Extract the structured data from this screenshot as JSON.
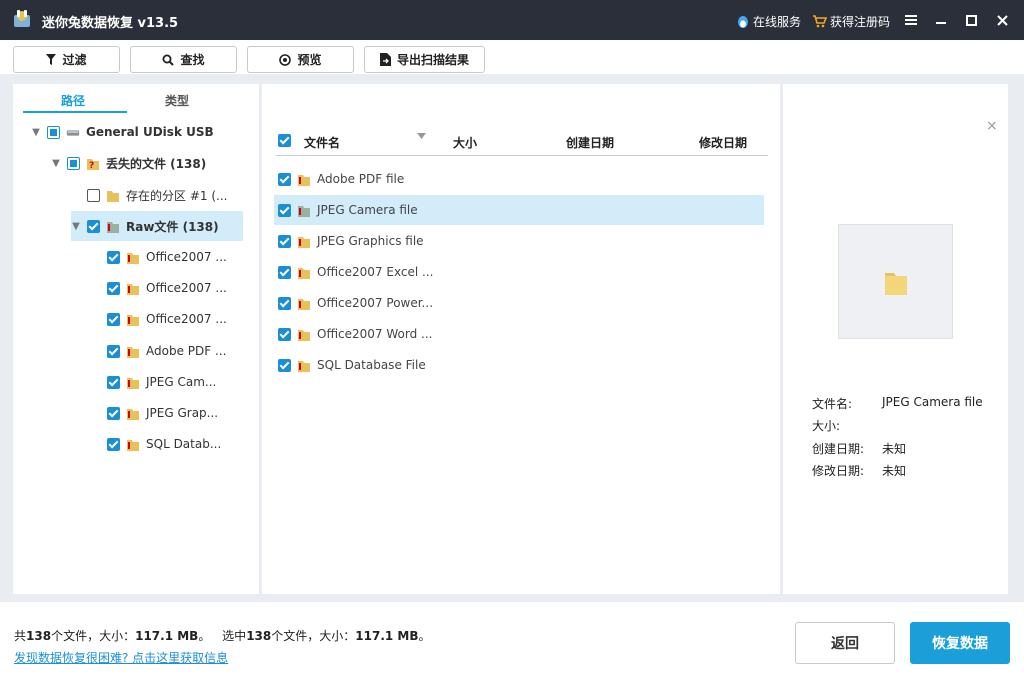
{
  "title": "迷你兔数据恢复 v13.5",
  "header": {
    "online_service": "在线服务",
    "get_code": "获得注册码"
  },
  "toolbar": {
    "filter": "过滤",
    "find": "查找",
    "preview": "预览",
    "export": "导出扫描结果"
  },
  "tabs": [
    "路径",
    "类型"
  ],
  "tree": [
    {
      "label": "General UDisk USB",
      "state": "partial",
      "expanded": true
    },
    {
      "label": "丢失的文件 (138)",
      "state": "partial",
      "expanded": true
    },
    {
      "label": "存在的分区 #1 (...",
      "state": "off"
    },
    {
      "label": "Raw文件 (138)",
      "state": "on",
      "expanded": true
    },
    {
      "label": "Office2007 ...",
      "state": "on"
    },
    {
      "label": "Office2007 ...",
      "state": "on"
    },
    {
      "label": "Office2007 ...",
      "state": "on"
    },
    {
      "label": "Adobe PDF ...",
      "state": "on"
    },
    {
      "label": "JPEG Cam...",
      "state": "on"
    },
    {
      "label": "JPEG Grap...",
      "state": "on"
    },
    {
      "label": "SQL Datab...",
      "state": "on"
    }
  ],
  "list": {
    "columns": [
      "文件名",
      "大小",
      "创建日期",
      "修改日期"
    ],
    "rows": [
      "Adobe PDF file",
      "JPEG Camera file",
      "JPEG Graphics file",
      "Office2007 Excel ...",
      "Office2007 Power...",
      "Office2007 Word ...",
      "SQL Database File"
    ]
  },
  "preview": {
    "close": "×",
    "labels": {
      "name": "文件名:",
      "size": "大小:",
      "created": "创建日期:",
      "modified": "修改日期:"
    },
    "values": {
      "name": "JPEG Camera file",
      "size": "",
      "created": "未知",
      "modified": "未知"
    }
  },
  "status": {
    "total_prefix": "共",
    "total_count": "138",
    "total_mid": "个文件，大小：",
    "total_size": "117.1 MB",
    "total_suffix": "。",
    "sel_prefix": "选中",
    "sel_count": "138",
    "sel_mid": "个文件，大小：",
    "sel_size": "117.1 MB",
    "sel_suffix": "。",
    "help_link": "发现数据恢复很困难? 点击这里获取信息"
  },
  "buttons": {
    "back": "返回",
    "recover": "恢复数据"
  },
  "colors": {
    "accent": "#1a9fd9",
    "titlebar": "#2b2f3a",
    "selection": "#d3ecf9"
  }
}
